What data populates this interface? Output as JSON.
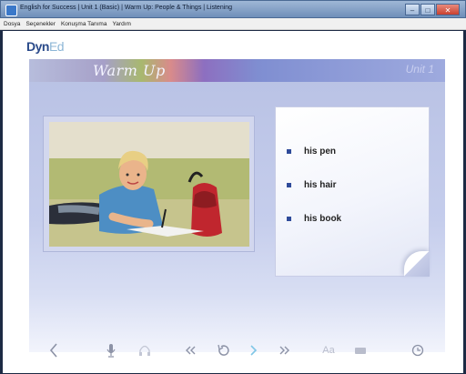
{
  "window": {
    "title": "English for Success | Unit 1 (Basic) | Warm Up: People & Things | Listening",
    "minimize": "–",
    "maximize": "□",
    "close": "✕"
  },
  "menu": [
    "Dosya",
    "Seçenekler",
    "Konuşma Tanıma",
    "Yardım"
  ],
  "logo": {
    "main": "Dyn",
    "accent": "Ed"
  },
  "banner": {
    "title": "Warm Up",
    "unit": "Unit 1"
  },
  "choices": [
    "his pen",
    "his hair",
    "his book"
  ],
  "toolbar": {
    "font_label": "Aa",
    "icons": [
      "back-arrow-icon",
      "microphone-icon",
      "headphones-icon",
      "rewind-icon",
      "replay-icon",
      "forward-icon",
      "fast-forward-icon",
      "text-size-icon",
      "keyboard-icon",
      "clock-icon"
    ]
  },
  "colors": {
    "accent": "#2f4b9a",
    "forward_active": "#7fc6e6"
  }
}
